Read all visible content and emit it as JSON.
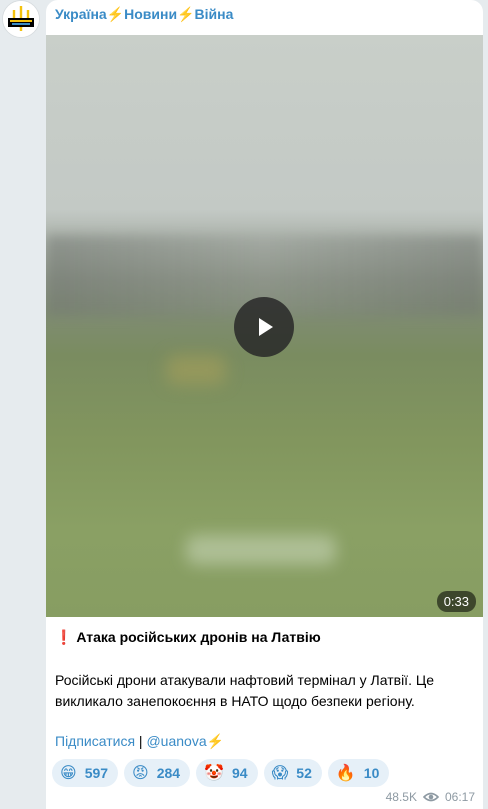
{
  "channel": {
    "name_part1": "Україна",
    "name_part2": "Новини",
    "name_part3": "Війна",
    "bolt": "⚡"
  },
  "video": {
    "duration": "0:33"
  },
  "post": {
    "headline_mark": "❗",
    "headline": "Атака російських дронів на Латвію",
    "body": "Російські дрони атакували нафтовий термінал у Латвії. Це викликало занепокоєння в НАТО щодо безпеки регіону.",
    "subscribe_link": "Підписатися",
    "separator": " | ",
    "handle": "@uanova",
    "handle_bolt": "⚡"
  },
  "reactions": [
    {
      "emoji": "😁",
      "count": "597"
    },
    {
      "emoji": "😡",
      "count": "284"
    },
    {
      "emoji": "🤡",
      "count": "94"
    },
    {
      "emoji": "😱",
      "count": "52"
    },
    {
      "emoji": "🔥",
      "count": "10"
    }
  ],
  "meta": {
    "views": "48.5K",
    "time": "06:17"
  }
}
